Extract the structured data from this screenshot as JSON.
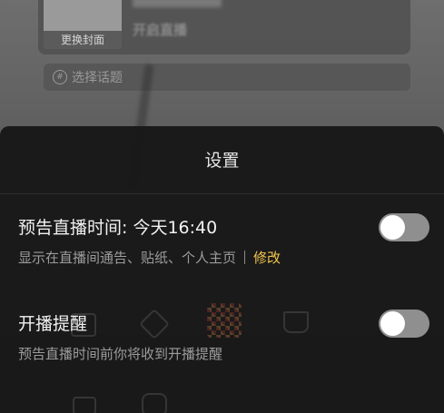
{
  "background": {
    "cover_label": "更换封面",
    "title_placeholder": "开启直播",
    "topic_label": "选择话题",
    "topic_icon": "hashtag-circle-icon"
  },
  "settings_sheet": {
    "title": "设置",
    "scheduled_live": {
      "label": "预告直播时间: 今天16:40",
      "description": "显示在直播间通告、贴纸、个人主页",
      "edit_label": "修改",
      "toggle_on": false
    },
    "start_reminder": {
      "label": "开播提醒",
      "description": "预告直播时间前你将收到开播提醒",
      "toggle_on": false
    }
  },
  "colors": {
    "accent": "#f3c64b",
    "sheet_bg": "#161616",
    "toggle_off_track": "#8f8f8f"
  }
}
